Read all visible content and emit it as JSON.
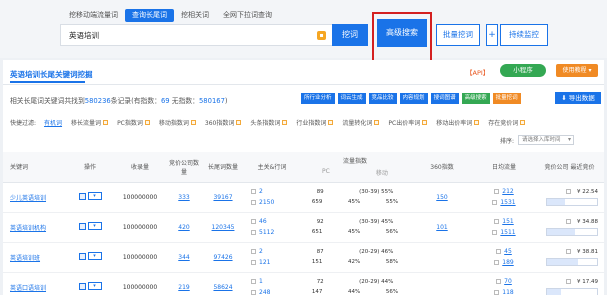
{
  "header": {
    "tabs": [
      {
        "label": "挖移动端流量词",
        "active": false
      },
      {
        "label": "查询长尾词",
        "active": true
      },
      {
        "label": "挖相关词",
        "active": false
      },
      {
        "label": "全网下拉词查询",
        "active": false
      }
    ],
    "search_value": "英语培训",
    "dig_label": "挖词",
    "advanced_label": "高级搜索",
    "batch_label": "批量挖词",
    "plus_label": "+",
    "monitor_label": "持续监控"
  },
  "panel": {
    "title": "英语培训长尾关键词挖掘",
    "api_label": "【API】",
    "mini_program_label": "小程序",
    "help_label": "使用教程 ▾",
    "summary_prefix": "相关长尾词关键词共找到",
    "summary_count": "580236",
    "summary_mid": "条记录(有指数：",
    "summary_index_count": "69",
    "summary_mid2": " 无指数：",
    "summary_noindex_count": "580167",
    "summary_suffix": ")",
    "tool_buttons": [
      "所行业分析",
      "词云生成",
      "竞品比较",
      "内容规划",
      "搜词图谱",
      "高级搜索",
      "批量挖词"
    ],
    "export_label": "导出数据",
    "filter_label": "快捷过滤:",
    "filters": [
      "有机词",
      "移长流量词",
      "PC指数词",
      "移动指数词",
      "360指数词",
      "头条指数词",
      "行业指数词",
      "流量转化词",
      "PC出价率词",
      "移动出价率词",
      "存在竞价词"
    ],
    "sort_label": "排序:",
    "sort_placeholder": "请选择入库时间"
  },
  "table": {
    "headers": [
      "关键词",
      "操作",
      "收录量",
      "竞价公司数量",
      "长尾词数量",
      "主关&行词",
      "流量指数",
      "360指数",
      "日均流量",
      "竞价公司 最近竞价"
    ],
    "flow_subheaders": [
      "PC",
      "移动"
    ],
    "rows": [
      {
        "keyword": "少儿英语培训",
        "op": "▾",
        "indexed": "100000000",
        "bid_companies": "333",
        "longtail": "39167",
        "main_a": "2",
        "main_b": "2150",
        "pc_a": "89",
        "pc_b": "659",
        "mob_range": "(30-39) 55%",
        "mob_pct1": "45%",
        "mob_pct2": "55%",
        "s360": "150",
        "daily_a": "212",
        "daily_b": "1531",
        "bid_price": "¥ 22.54",
        "bid_fill": 0.35
      },
      {
        "keyword": "英语培训机构",
        "op": "▾",
        "indexed": "100000000",
        "bid_companies": "420",
        "longtail": "120345",
        "main_a": "46",
        "main_b": "5112",
        "pc_a": "92",
        "pc_b": "651",
        "mob_range": "(30-39) 45%",
        "mob_pct1": "45%",
        "mob_pct2": "56%",
        "s360": "101",
        "daily_a": "151",
        "daily_b": "1511",
        "bid_price": "¥ 34.88",
        "bid_fill": 0.55
      },
      {
        "keyword": "英语培训班",
        "op": "▾",
        "indexed": "100000000",
        "bid_companies": "344",
        "longtail": "97426",
        "main_a": "2",
        "main_b": "121",
        "pc_a": "87",
        "pc_b": "151",
        "mob_range": "(20-29) 46%",
        "mob_pct1": "42%",
        "mob_pct2": "58%",
        "s360": "",
        "daily_a": "45",
        "daily_b": "189",
        "bid_price": "¥ 38.81",
        "bid_fill": 0.62
      },
      {
        "keyword": "英语口语培训",
        "op": "▾",
        "indexed": "100000000",
        "bid_companies": "219",
        "longtail": "58624",
        "main_a": "1",
        "main_b": "248",
        "pc_a": "72",
        "pc_b": "147",
        "mob_range": "(20-29) 44%",
        "mob_pct1": "44%",
        "mob_pct2": "56%",
        "s360": "",
        "daily_a": "70",
        "daily_b": "118",
        "bid_price": "¥ 17.49",
        "bid_fill": 0.28
      }
    ]
  }
}
